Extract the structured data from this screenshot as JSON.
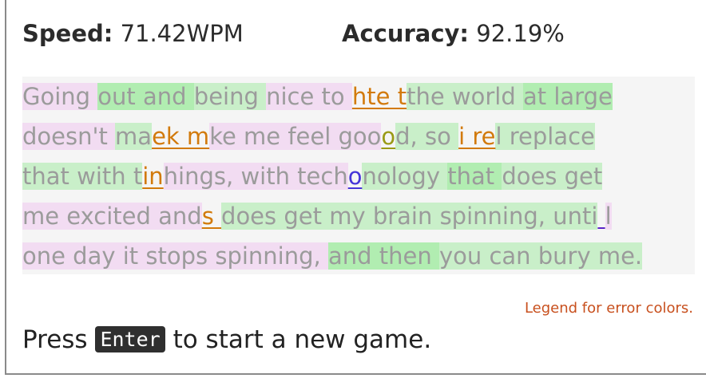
{
  "stats": {
    "speed_label": "Speed:",
    "speed_value": "71.42WPM",
    "accuracy_label": "Accuracy:",
    "accuracy_value": "92.19%"
  },
  "passage": {
    "lines": [
      [
        "Going ",
        "out and ",
        "being ",
        "nice to ",
        "hte t",
        "the world ",
        "at large"
      ],
      [
        "doesn't ",
        "ma",
        "ek m",
        "ke me feel goo",
        "o",
        "d, so ",
        "i re",
        "l replace"
      ],
      [
        "that with t",
        "in",
        "hings, with tech",
        "o",
        "nology ",
        "that ",
        "does get"
      ],
      [
        "me excited and",
        "s ",
        "does get my brain spinning, unti",
        " ",
        "l"
      ],
      [
        "one day it stops spinning, ",
        "and then ",
        "you can bury me."
      ]
    ]
  },
  "legend": {
    "label": "Legend for error colors."
  },
  "footer": {
    "press_text": "Press ",
    "key_label": "Enter",
    "after_text": " to start a new game."
  },
  "colors": {
    "error_transposition": "#d27a0c",
    "error_extra": "#d4279c",
    "error_wrong": "#9a9a16",
    "error_missing": "#5a23c8",
    "correct_fast": "#9ee89e",
    "slow_highlight": "#f0bef0"
  }
}
